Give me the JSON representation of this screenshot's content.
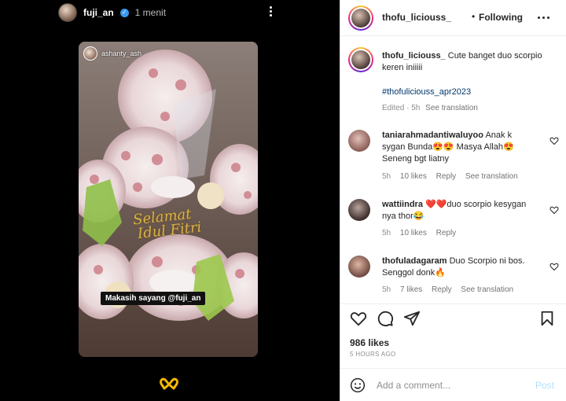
{
  "story": {
    "username": "fuji_an",
    "time": "1 menit",
    "repost_username": "ashanty_ash",
    "greeting_line1": "Selamat",
    "greeting_line2": "Idul Fitri",
    "sticker_text": "Makasih sayang @fuji_an"
  },
  "post": {
    "author": "thofu_liciouss_",
    "separator": "•",
    "follow_status": "Following",
    "caption": "Cute banget duo scorpio keren iniiiii",
    "hashtag": "#thofuliciouss_apr2023",
    "edited": "Edited · 5h",
    "see_translation": "See translation",
    "likes": "986 likes",
    "time_ago": "5 HOURS AGO",
    "add_comment_placeholder": "Add a comment...",
    "post_label": "Post"
  },
  "comments": [
    {
      "username": "taniarahmadantiwaluyoo",
      "text": "Anak k sygan Bunda😍😍 Masya Allah😍 Seneng bgt liatny",
      "time": "5h",
      "likes": "10 likes",
      "reply": "Reply",
      "translate": "See translation",
      "avatar_color": "#b98d86"
    },
    {
      "username": "wattiindra",
      "text": "❤️❤️duo scorpio kesygan nya thor😂",
      "time": "5h",
      "likes": "10 likes",
      "reply": "Reply",
      "translate": "",
      "avatar_color": "#5a4a48"
    },
    {
      "username": "thofuladagaram",
      "text": "Duo Scorpio ni bos. Senggol donk🔥",
      "time": "5h",
      "likes": "7 likes",
      "reply": "Reply",
      "translate": "See translation",
      "avatar_color": "#9a6a5c"
    }
  ],
  "icons": {
    "heart": "heart-icon",
    "comment": "comment-icon",
    "share": "share-icon",
    "save": "bookmark-icon",
    "emoji": "emoji-icon",
    "more": "more-icon"
  },
  "colors": {
    "link": "#00376b",
    "post_button": "#b2dffc",
    "heart_reaction": "#f5b800"
  }
}
